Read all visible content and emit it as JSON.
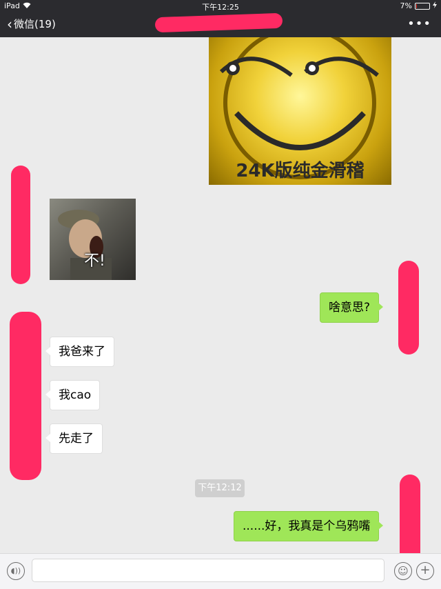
{
  "status_bar": {
    "device": "iPad",
    "time": "下午12:25",
    "battery": "7%",
    "battery_level": 0.07
  },
  "nav": {
    "back_label": "微信(19)",
    "more_label": "•••"
  },
  "messages": [
    {
      "type": "image",
      "direction": "out",
      "caption": "24K版纯金滑稽"
    },
    {
      "type": "sticker",
      "direction": "in",
      "caption": "不!"
    },
    {
      "type": "text",
      "direction": "out",
      "text": "啥意思?"
    },
    {
      "type": "text",
      "direction": "in",
      "text": "我爸来了"
    },
    {
      "type": "text",
      "direction": "in",
      "text": "我cao"
    },
    {
      "type": "text",
      "direction": "in",
      "text": "先走了"
    },
    {
      "type": "timestamp",
      "text": "下午12:12"
    },
    {
      "type": "text",
      "direction": "out",
      "text": "......好，我真是个乌鸦嘴"
    }
  ],
  "colors": {
    "nav_bg": "#2b2b2f",
    "out_bubble": "#9fe658",
    "in_bubble": "#ffffff",
    "redaction": "#ff2a63",
    "chat_bg": "#ebebeb"
  }
}
